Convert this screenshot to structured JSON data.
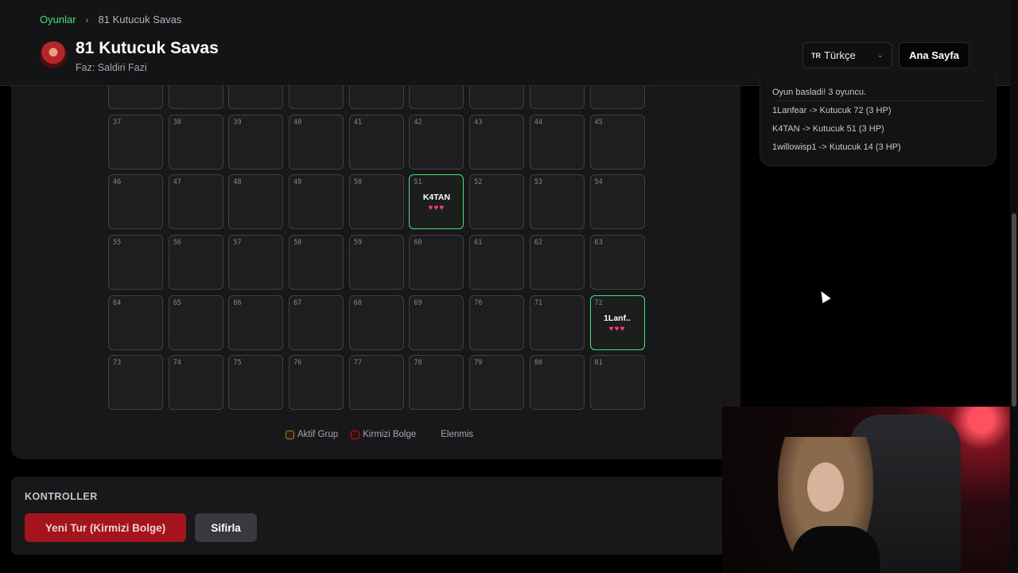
{
  "header": {
    "breadcrumb_root": "Oyunlar",
    "breadcrumb_sep": "›",
    "breadcrumb_current": "81 Kutucuk Savas",
    "title": "81 Kutucuk Savas",
    "phase": "Faz: Saldiri Fazi",
    "language_flag": "TR",
    "language": "Türkçe",
    "home_button": "Ana Sayfa"
  },
  "board": {
    "cells": [
      {
        "num": "",
        "player": "",
        "hearts": ""
      },
      {
        "num": "",
        "player": "",
        "hearts": ""
      },
      {
        "num": "",
        "player": "",
        "hearts": ""
      },
      {
        "num": "",
        "player": "",
        "hearts": ""
      },
      {
        "num": "",
        "player": "",
        "hearts": ""
      },
      {
        "num": "",
        "player": "",
        "hearts": ""
      },
      {
        "num": "",
        "player": "",
        "hearts": ""
      },
      {
        "num": "",
        "player": "",
        "hearts": ""
      },
      {
        "num": "",
        "player": "",
        "hearts": ""
      },
      {
        "num": "37",
        "player": "",
        "hearts": ""
      },
      {
        "num": "38",
        "player": "",
        "hearts": ""
      },
      {
        "num": "39",
        "player": "",
        "hearts": ""
      },
      {
        "num": "40",
        "player": "",
        "hearts": ""
      },
      {
        "num": "41",
        "player": "",
        "hearts": ""
      },
      {
        "num": "42",
        "player": "",
        "hearts": ""
      },
      {
        "num": "43",
        "player": "",
        "hearts": ""
      },
      {
        "num": "44",
        "player": "",
        "hearts": ""
      },
      {
        "num": "45",
        "player": "",
        "hearts": ""
      },
      {
        "num": "46",
        "player": "",
        "hearts": ""
      },
      {
        "num": "47",
        "player": "",
        "hearts": ""
      },
      {
        "num": "48",
        "player": "",
        "hearts": ""
      },
      {
        "num": "49",
        "player": "",
        "hearts": ""
      },
      {
        "num": "50",
        "player": "",
        "hearts": ""
      },
      {
        "num": "51",
        "player": "K4TAN",
        "hearts": "♥♥♥"
      },
      {
        "num": "52",
        "player": "",
        "hearts": ""
      },
      {
        "num": "53",
        "player": "",
        "hearts": ""
      },
      {
        "num": "54",
        "player": "",
        "hearts": ""
      },
      {
        "num": "55",
        "player": "",
        "hearts": ""
      },
      {
        "num": "56",
        "player": "",
        "hearts": ""
      },
      {
        "num": "57",
        "player": "",
        "hearts": ""
      },
      {
        "num": "58",
        "player": "",
        "hearts": ""
      },
      {
        "num": "59",
        "player": "",
        "hearts": ""
      },
      {
        "num": "60",
        "player": "",
        "hearts": ""
      },
      {
        "num": "61",
        "player": "",
        "hearts": ""
      },
      {
        "num": "62",
        "player": "",
        "hearts": ""
      },
      {
        "num": "63",
        "player": "",
        "hearts": ""
      },
      {
        "num": "64",
        "player": "",
        "hearts": ""
      },
      {
        "num": "65",
        "player": "",
        "hearts": ""
      },
      {
        "num": "66",
        "player": "",
        "hearts": ""
      },
      {
        "num": "67",
        "player": "",
        "hearts": ""
      },
      {
        "num": "68",
        "player": "",
        "hearts": ""
      },
      {
        "num": "69",
        "player": "",
        "hearts": ""
      },
      {
        "num": "70",
        "player": "",
        "hearts": ""
      },
      {
        "num": "71",
        "player": "",
        "hearts": ""
      },
      {
        "num": "72",
        "player": "1Lanf..",
        "hearts": "♥♥♥"
      },
      {
        "num": "73",
        "player": "",
        "hearts": ""
      },
      {
        "num": "74",
        "player": "",
        "hearts": ""
      },
      {
        "num": "75",
        "player": "",
        "hearts": ""
      },
      {
        "num": "76",
        "player": "",
        "hearts": ""
      },
      {
        "num": "77",
        "player": "",
        "hearts": ""
      },
      {
        "num": "78",
        "player": "",
        "hearts": ""
      },
      {
        "num": "79",
        "player": "",
        "hearts": ""
      },
      {
        "num": "80",
        "player": "",
        "hearts": ""
      },
      {
        "num": "81",
        "player": "",
        "hearts": ""
      }
    ],
    "legend": {
      "active": "Aktif Grup",
      "red": "Kirmizi Bolge",
      "eliminated": "Elenmis"
    }
  },
  "log": {
    "entries": [
      "Oyun basladi! 3 oyuncu.",
      "1Lanfear -> Kutucuk 72 (3 HP)",
      "K4TAN -> Kutucuk 51 (3 HP)",
      "1willowisp1 -> Kutucuk 14 (3 HP)"
    ]
  },
  "controls": {
    "title": "KONTROLLER",
    "new_turn_button": "Yeni Tur (Kirmizi Bolge)",
    "reset_button": "Sifirla"
  },
  "colors": {
    "accent_green": "#4ade80",
    "danger_red": "#a4141c",
    "heart_pink": "#f43f7a"
  }
}
